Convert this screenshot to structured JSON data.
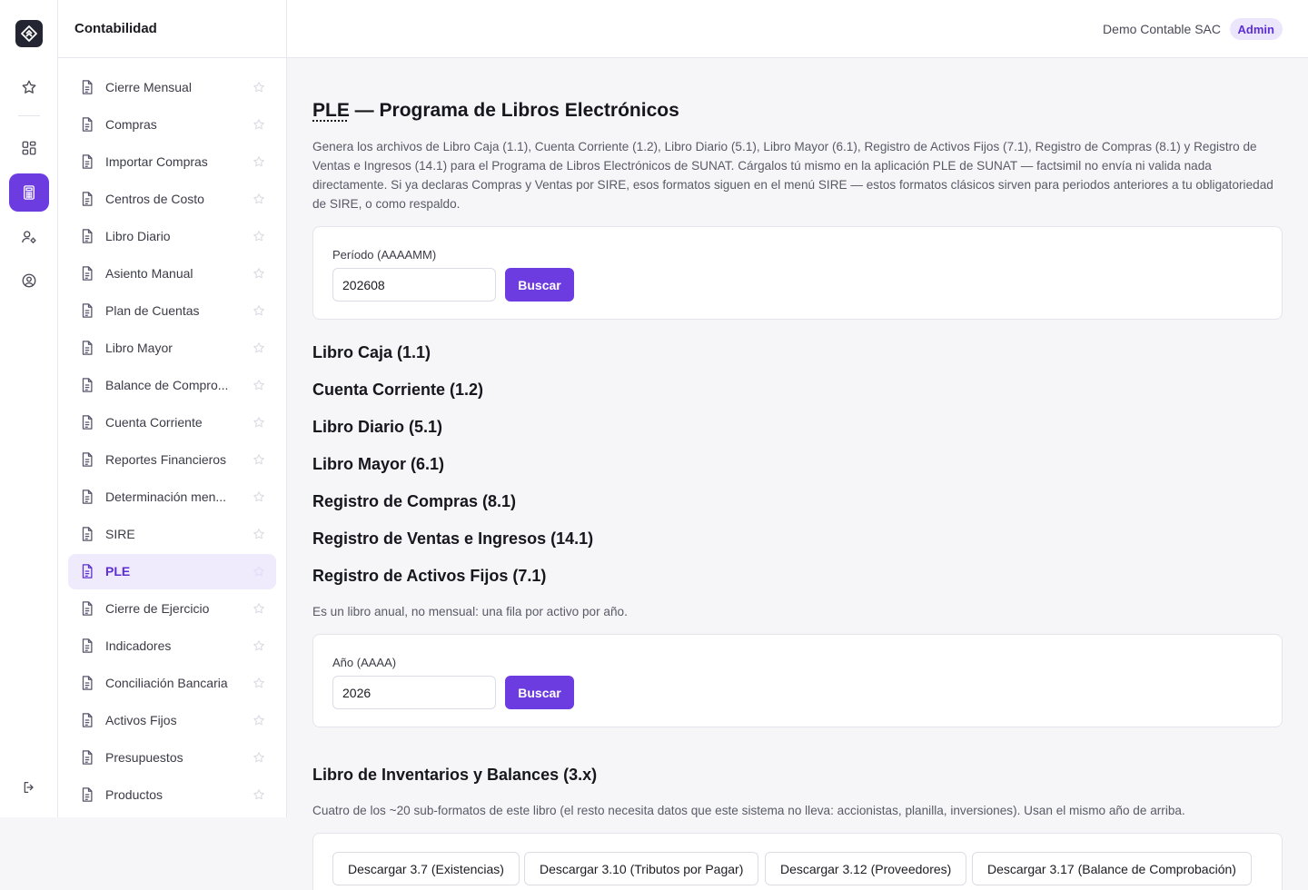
{
  "rail": {
    "icons": [
      "logo-icon",
      "star-icon",
      "dashboard-icon",
      "calculator-icon",
      "users-settings-icon",
      "user-circle-icon",
      "logout-icon"
    ]
  },
  "menu": {
    "title": "Contabilidad",
    "items": [
      {
        "label": "Cierre Mensual",
        "active": false
      },
      {
        "label": "Compras",
        "active": false
      },
      {
        "label": "Importar Compras",
        "active": false
      },
      {
        "label": "Centros de Costo",
        "active": false
      },
      {
        "label": "Libro Diario",
        "active": false
      },
      {
        "label": "Asiento Manual",
        "active": false
      },
      {
        "label": "Plan de Cuentas",
        "active": false
      },
      {
        "label": "Libro Mayor",
        "active": false
      },
      {
        "label": "Balance de Compro...",
        "active": false
      },
      {
        "label": "Cuenta Corriente",
        "active": false
      },
      {
        "label": "Reportes Financieros",
        "active": false
      },
      {
        "label": "Determinación men...",
        "active": false
      },
      {
        "label": "SIRE",
        "active": false
      },
      {
        "label": "PLE",
        "active": true
      },
      {
        "label": "Cierre de Ejercicio",
        "active": false
      },
      {
        "label": "Indicadores",
        "active": false
      },
      {
        "label": "Conciliación Bancaria",
        "active": false
      },
      {
        "label": "Activos Fijos",
        "active": false
      },
      {
        "label": "Presupuestos",
        "active": false
      },
      {
        "label": "Productos",
        "active": false
      }
    ]
  },
  "header": {
    "company": "Demo Contable SAC",
    "role": "Admin"
  },
  "page": {
    "title_abbr": "PLE",
    "title_rest": " — Programa de Libros Electrónicos",
    "intro": "Genera los archivos de Libro Caja (1.1), Cuenta Corriente (1.2), Libro Diario (5.1), Libro Mayor (6.1), Registro de Activos Fijos (7.1), Registro de Compras (8.1) y Registro de Ventas e Ingresos (14.1) para el Programa de Libros Electrónicos de SUNAT. Cárgalos tú mismo en la aplicación PLE de SUNAT — factsimil no envía ni valida nada directamente. Si ya declaras Compras y Ventas por SIRE, esos formatos siguen en el menú SIRE — estos formatos clásicos sirven para periodos anteriores a tu obligatoriedad de SIRE, o como respaldo."
  },
  "period_form": {
    "label": "Período (AAAAMM)",
    "value": "202608",
    "button": "Buscar"
  },
  "books": [
    "Libro Caja (1.1)",
    "Cuenta Corriente (1.2)",
    "Libro Diario (5.1)",
    "Libro Mayor (6.1)",
    "Registro de Compras (8.1)",
    "Registro de Ventas e Ingresos (14.1)",
    "Registro de Activos Fijos (7.1)"
  ],
  "fixed_assets_note": "Es un libro anual, no mensual: una fila por activo por año.",
  "year_form": {
    "label": "Año (AAAA)",
    "value": "2026",
    "button": "Buscar"
  },
  "inventory": {
    "title": "Libro de Inventarios y Balances (3.x)",
    "note": "Cuatro de los ~20 sub-formatos de este libro (el resto necesita datos que este sistema no lleva: accionistas, planilla, inversiones). Usan el mismo año de arriba.",
    "buttons": [
      "Descargar 3.7 (Existencias)",
      "Descargar 3.10 (Tributos por Pagar)",
      "Descargar 3.12 (Proveedores)",
      "Descargar 3.17 (Balance de Comprobación)"
    ]
  },
  "colors": {
    "accent": "#6d3ce0",
    "active_bg": "#efeafc",
    "badge_bg": "#ece6fc"
  }
}
